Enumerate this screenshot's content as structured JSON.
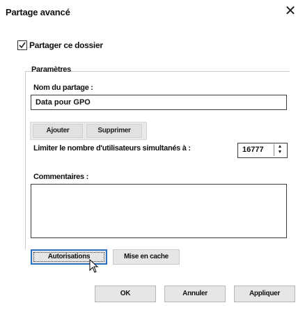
{
  "dialog": {
    "title": "Partage avancé",
    "close_icon": "close-icon"
  },
  "share_checkbox": {
    "label": "Partager ce dossier",
    "checked": true
  },
  "settings": {
    "group_label": "Paramètres",
    "share_name_label": "Nom du partage :",
    "share_name_value": "Data pour GPO",
    "add_label": "Ajouter",
    "remove_label": "Supprimer",
    "limit_label": "Limiter le nombre d'utilisateurs simultanés à :",
    "limit_value": "16777",
    "comments_label": "Commentaires :"
  },
  "actions": {
    "permissions_label": "Autorisations",
    "caching_label": "Mise en cache"
  },
  "footer": {
    "ok_label": "OK",
    "cancel_label": "Annuler",
    "apply_label": "Appliquer"
  },
  "colors": {
    "focus_border": "#2a6fc4",
    "button_bg": "#e6e6e6"
  }
}
